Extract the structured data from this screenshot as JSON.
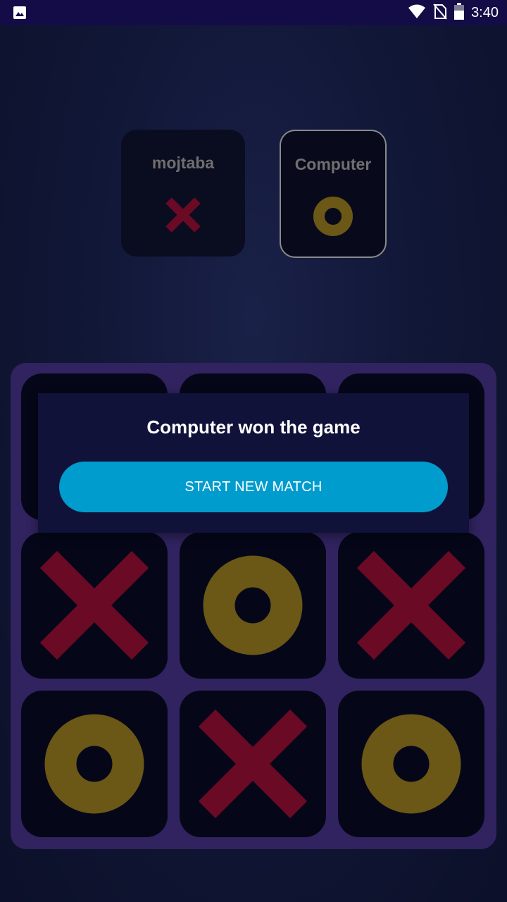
{
  "status_bar": {
    "time": "3:40",
    "icons": [
      "image-notification-icon",
      "wifi-icon",
      "no-sim-icon",
      "battery-icon"
    ]
  },
  "players": [
    {
      "name": "mojtaba",
      "mark": "X",
      "active": false
    },
    {
      "name": "Computer",
      "mark": "O",
      "active": true
    }
  ],
  "colors": {
    "x_mark": "#6b0a24",
    "o_mark": "#6b5716",
    "button": "#009ccd",
    "board": "#30235f",
    "cell": "#050719"
  },
  "board": {
    "cells": [
      [
        "",
        "",
        ""
      ],
      [
        "X",
        "O",
        "X"
      ],
      [
        "O",
        "X",
        "O"
      ]
    ]
  },
  "dialog": {
    "message": "Computer won the game",
    "button_label": "START NEW MATCH"
  }
}
